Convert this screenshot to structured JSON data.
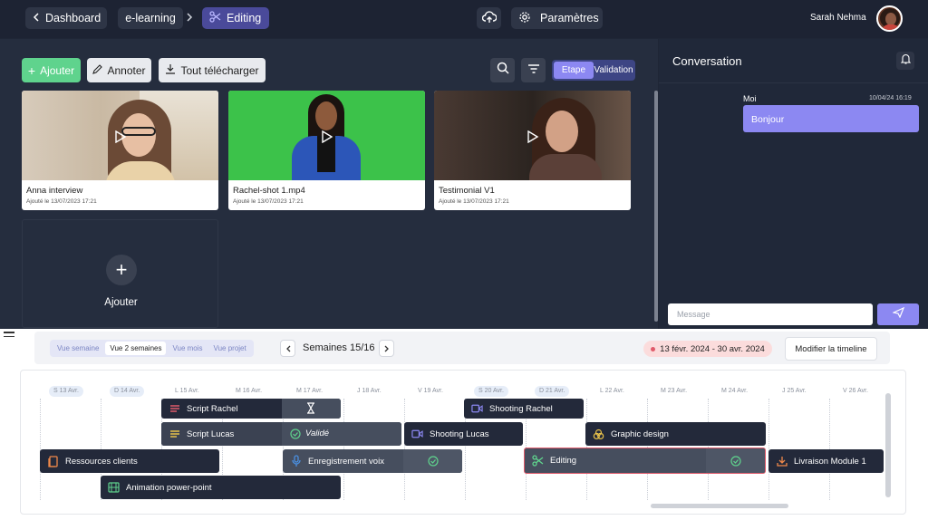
{
  "topbar": {
    "back_label": "Dashboard",
    "project": "e-learning",
    "current": "Editing",
    "settings_label": "Paramètres",
    "user_name": "Sarah Nehma"
  },
  "toolbar": {
    "add_label": "Ajouter",
    "annotate_label": "Annoter",
    "download_label": "Tout télécharger",
    "seg_etape": "Etape",
    "seg_validation": "Validation"
  },
  "media": [
    {
      "title": "Anna interview",
      "date": "Ajouté le 13/07/2023 17:21"
    },
    {
      "title": "Rachel-shot 1.mp4",
      "date": "Ajouté le 13/07/2023 17:21"
    },
    {
      "title": "Testimonial V1",
      "date": "Ajouté le 13/07/2023 17:21"
    }
  ],
  "add_card_label": "Ajouter",
  "conversation": {
    "title": "Conversation",
    "sender": "Moi",
    "timestamp": "10/04/24 16:19",
    "message": "Bonjour",
    "input_placeholder": "Message"
  },
  "timeline": {
    "views": [
      "Vue semaine",
      "Vue 2 semaines",
      "Vue mois",
      "Vue projet"
    ],
    "active_view": "Vue 2 semaines",
    "weeks_label": "Semaines 15/16",
    "date_range": "13 févr. 2024 - 30 avr. 2024",
    "modify_label": "Modifier la timeline",
    "days": [
      "S 13 Avr.",
      "D 14 Avr.",
      "L 15 Avr.",
      "M 16 Avr.",
      "M 17 Avr.",
      "J 18 Avr.",
      "V 19 Avr.",
      "S 20 Avr.",
      "D 21 Avr.",
      "L 22 Avr.",
      "M 23 Avr.",
      "M 24 Avr.",
      "J 25 Avr.",
      "V 26 Avr."
    ],
    "tasks": {
      "script_rachel": "Script Rachel",
      "shooting_rachel": "Shooting Rachel",
      "script_lucas": "Script Lucas",
      "valide": "Validé",
      "shooting_lucas": "Shooting Lucas",
      "graphic_design": "Graphic design",
      "ressources": "Ressources clients",
      "enregistrement": "Enregistrement voix",
      "editing": "Editing",
      "livraison": "Livraison Module 1",
      "animation": "Animation power-point"
    }
  },
  "colors": {
    "accent": "#8c88f2",
    "green": "#5fd38d",
    "red": "#e05a6a"
  }
}
